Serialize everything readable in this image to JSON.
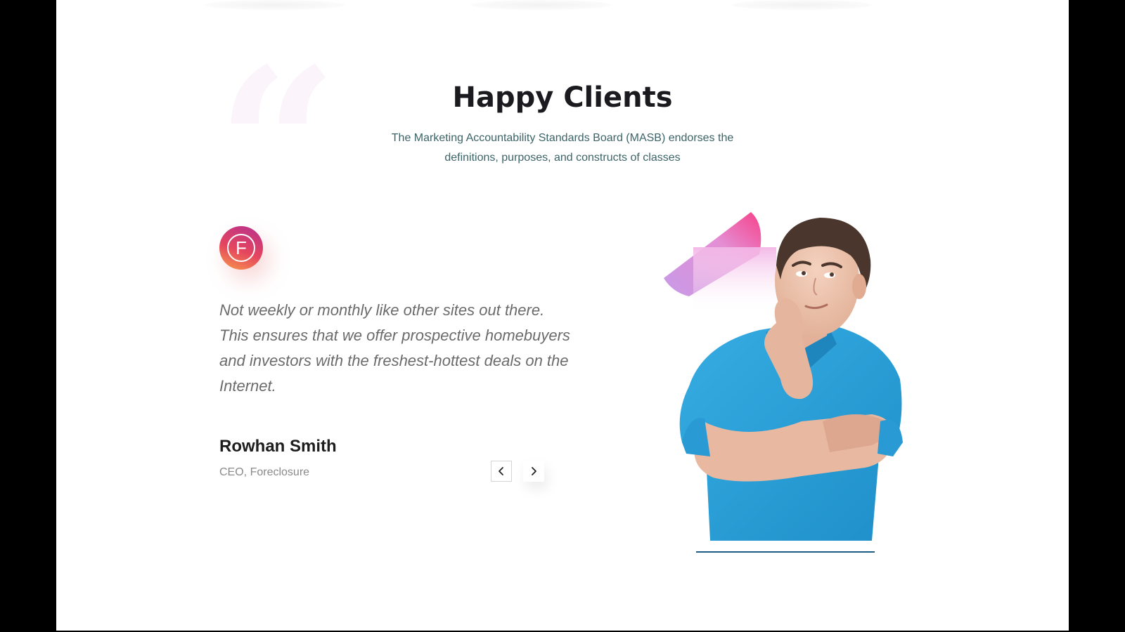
{
  "section": {
    "title": "Happy Clients",
    "subtitle": "The Marketing Accountability Standards Board (MASB) endorses the definitions, purposes, and constructs of classes"
  },
  "testimonial": {
    "brand_letter": "F",
    "quote": "Not weekly or monthly like other sites out there. This ensures that we offer prospective homebuyers and investors with the freshest-hottest deals on the Internet.",
    "author_name": "Rowhan Smith",
    "author_role": "CEO, Foreclosure"
  },
  "icons": {
    "quote": "quote-mark-icon",
    "prev": "chevron-left-icon",
    "next": "chevron-right-icon"
  },
  "colors": {
    "background": "#ffffff",
    "frame": "#000000",
    "title": "#1b1b1f",
    "subtitle": "#3c6468",
    "quote_text": "#6b6b6b",
    "badge_gradient": [
      "#b6308f",
      "#e5455e",
      "#f79a4c"
    ],
    "shirt": "#2aa3dc",
    "underline": "#1d5c86"
  }
}
